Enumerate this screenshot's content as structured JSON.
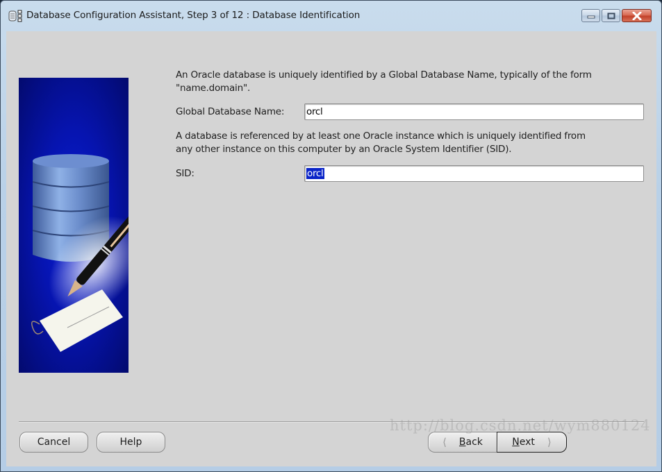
{
  "window": {
    "title": "Database Configuration Assistant, Step 3 of 12 : Database Identification",
    "app_icon": "database-config-icon",
    "controls": {
      "minimize": "minimize-icon",
      "maximize": "maximize-icon",
      "close": "close-icon"
    }
  },
  "banner": {
    "image": "database-pen-tag-illustration"
  },
  "form": {
    "intro_text_line1": "An Oracle database is uniquely identified by a Global Database Name, typically of the form",
    "intro_text_line2": "\"name.domain\".",
    "global_db_name_label": "Global Database Name:",
    "global_db_name_value": "orcl",
    "sid_text_line1": "A database is referenced by at least one Oracle instance which is uniquely identified from",
    "sid_text_line2": "any other instance on this computer by an Oracle System Identifier (SID).",
    "sid_label": "SID:",
    "sid_value": "orcl"
  },
  "footer": {
    "cancel_label": "Cancel",
    "help_label": "Help",
    "back_label_mnemonic": "B",
    "back_label_rest": "ack",
    "next_label_mnemonic": "N",
    "next_label_rest": "ext"
  },
  "watermark": "http://blog.csdn.net/wym880124"
}
